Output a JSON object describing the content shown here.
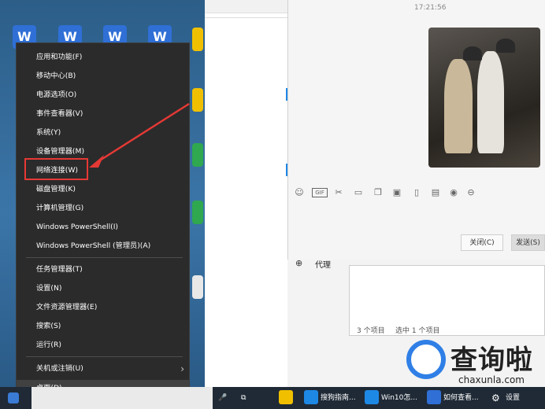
{
  "context_menu": {
    "items": [
      "应用和功能(F)",
      "移动中心(B)",
      "电源选项(O)",
      "事件查看器(V)",
      "系统(Y)",
      "设备管理器(M)",
      "网络连接(W)",
      "磁盘管理(K)",
      "计算机管理(G)",
      "Windows PowerShell(I)",
      "Windows PowerShell (管理员)(A)",
      "任务管理器(T)",
      "设置(N)",
      "文件资源管理器(E)",
      "搜索(S)",
      "运行(R)",
      "关机或注销(U)",
      "桌面(D)"
    ]
  },
  "chat": {
    "time": "17:21:56",
    "close_button": "关闭(C)",
    "send_button": "发送(S)"
  },
  "settings": {
    "proxy_label": "代理"
  },
  "explorer": {
    "item_count": "3 个项目",
    "selected_count": "选中 1 个项目"
  },
  "taskbar": {
    "item_sogou": "搜狗指南...",
    "item_win10": "Win10怎...",
    "item_howto": "如何查看...",
    "item_settings": "设置"
  },
  "watermark": {
    "title": "查询啦",
    "domain": "chaxunla.com"
  },
  "colors": {
    "highlight_box": "#e53935",
    "accent": "#2f7fe6"
  }
}
